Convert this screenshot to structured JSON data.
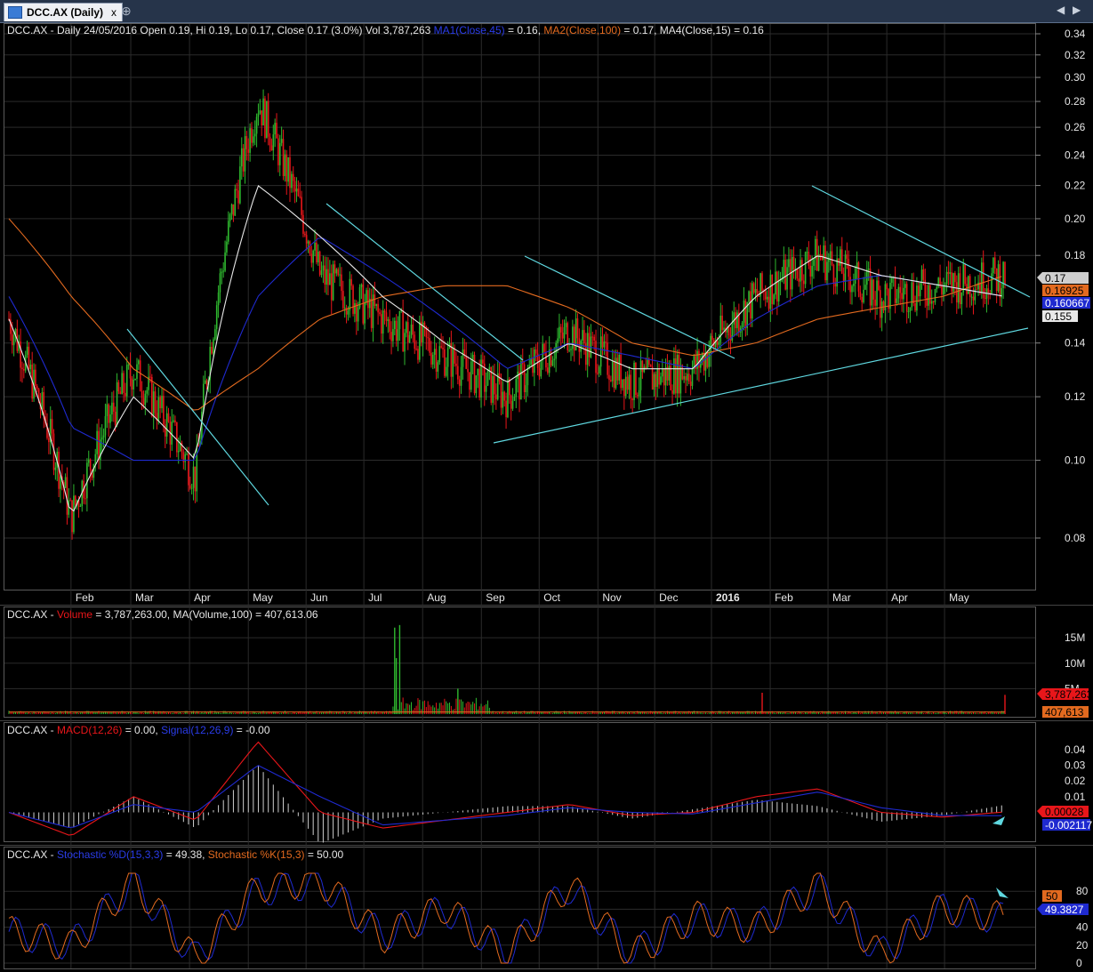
{
  "tab": {
    "title": "DCC.AX (Daily)",
    "close": "x",
    "pin": "⊕",
    "nav_prev": "◀",
    "nav_next": "▶"
  },
  "panes": {
    "price": {
      "info": {
        "ticker": "DCC.AX - Daily 24/05/2016 Open 0.19, Hi 0.19, Lo 0.17, Close 0.17 (3.0%) Vol 3,787,263 ",
        "ma1": "MA1(Close,45)",
        "ma1_val": " = 0.16, ",
        "ma2": "MA2(Close,100)",
        "ma2_val": " = 0.17, MA4(Close,15) = 0.16"
      },
      "tags": [
        "0.17",
        "0.16925",
        "0.160667",
        "0.155"
      ],
      "months": [
        "Feb",
        "Mar",
        "Apr",
        "May",
        "Jun",
        "Jul",
        "Aug",
        "Sep",
        "Oct",
        "Nov",
        "Dec",
        "2016",
        "Feb",
        "Mar",
        "Apr",
        "May"
      ],
      "y_ticks": [
        "0.34",
        "0.32",
        "0.30",
        "0.28",
        "0.26",
        "0.24",
        "0.22",
        "0.20",
        "0.18",
        "0.14",
        "0.12",
        "0.10",
        "0.08"
      ]
    },
    "volume": {
      "info": {
        "ticker": "DCC.AX - ",
        "vol": "Volume",
        "vol_val": " = 3,787,263.00, MA(Volume,100) = 407,613.06"
      },
      "tags": [
        "3,787,263",
        "407,613"
      ],
      "y_ticks": [
        "15M",
        "10M",
        "5M"
      ]
    },
    "macd": {
      "info": {
        "ticker": "DCC.AX - ",
        "macd": "MACD(12,26)",
        "macd_val": " = 0.00, ",
        "signal": "Signal(12,26,9)",
        "signal_val": " = -0.00"
      },
      "tags": [
        "0.00028",
        "-0.002117"
      ],
      "y_ticks": [
        "0.04",
        "0.03",
        "0.02",
        "0.01"
      ]
    },
    "stoch": {
      "info": {
        "ticker": "DCC.AX - ",
        "d": "Stochastic %D(15,3,3)",
        "d_val": " = 49.38, ",
        "k": "Stochastic %K(15,3)",
        "k_val": " = 50.00"
      },
      "tags": [
        "50",
        "49.3827"
      ],
      "y_ticks": [
        "80",
        "60",
        "40",
        "20",
        "0"
      ]
    }
  },
  "colors": {
    "bg": "#000000",
    "up": "#2fb82f",
    "down": "#e8161a",
    "ma_fast": "#e8e8e8",
    "ma_mid": "#1f2ad0",
    "ma_slow": "#e36a1f",
    "trend": "#5fd8e0",
    "grid": "#2b2b2b",
    "text": "#e6e6e6"
  },
  "chart_data": [
    {
      "type": "line",
      "title": "DCC.AX - Daily",
      "description_series": "Daily candlestick price with moving averages (approximate values read from chart)",
      "x": [
        "2015-01",
        "2015-02",
        "2015-03",
        "2015-04",
        "2015-05",
        "2015-06",
        "2015-07",
        "2015-08",
        "2015-09",
        "2015-10",
        "2015-11",
        "2015-12",
        "2016-01",
        "2016-02",
        "2016-03",
        "2016-04",
        "2016-05"
      ],
      "series": [
        {
          "name": "Close",
          "values": [
            0.15,
            0.085,
            0.13,
            0.095,
            0.28,
            0.17,
            0.15,
            0.135,
            0.12,
            0.145,
            0.125,
            0.13,
            0.16,
            0.18,
            0.16,
            0.165,
            0.17
          ]
        },
        {
          "name": "MA1(Close,45)",
          "values": [
            0.16,
            0.11,
            0.1,
            0.1,
            0.16,
            0.19,
            0.17,
            0.15,
            0.13,
            0.14,
            0.135,
            0.13,
            0.15,
            0.165,
            0.17,
            0.165,
            0.16
          ]
        },
        {
          "name": "MA2(Close,100)",
          "values": [
            0.2,
            0.16,
            0.13,
            0.115,
            0.13,
            0.15,
            0.16,
            0.165,
            0.165,
            0.155,
            0.14,
            0.135,
            0.14,
            0.15,
            0.155,
            0.16,
            0.17
          ]
        },
        {
          "name": "MA4(Close,15)",
          "values": [
            0.15,
            0.085,
            0.12,
            0.1,
            0.22,
            0.19,
            0.16,
            0.14,
            0.125,
            0.14,
            0.13,
            0.13,
            0.16,
            0.18,
            0.17,
            0.165,
            0.16
          ]
        }
      ],
      "ylim": [
        0.07,
        0.35
      ],
      "y_scale": "log",
      "grid": true,
      "last": {
        "open": 0.19,
        "high": 0.19,
        "low": 0.17,
        "close": 0.17,
        "volume": 3787263
      }
    },
    {
      "type": "bar",
      "title": "Volume",
      "x": [
        "2015-05-05",
        "2015-05-06",
        "2015-05-08",
        "2015-05-20",
        "2016-02-10",
        "2016-05-24"
      ],
      "values": [
        17000000,
        11000000,
        17500000,
        5000000,
        4200000,
        3787263
      ],
      "ma100": 407613.06,
      "ylim": [
        0,
        18000000
      ]
    },
    {
      "type": "line",
      "title": "MACD(12,26)",
      "series": [
        {
          "name": "MACD(12,26)",
          "values": [
            0.0,
            -0.015,
            0.01,
            -0.005,
            0.045,
            0.0,
            -0.01,
            -0.005,
            0.0,
            0.005,
            -0.002,
            0.0,
            0.01,
            0.015,
            0.0,
            -0.003,
            0.00028
          ]
        },
        {
          "name": "Signal(12,26,9)",
          "values": [
            0.0,
            -0.01,
            0.005,
            0.0,
            0.03,
            0.01,
            -0.008,
            -0.005,
            -0.002,
            0.003,
            0.0,
            -0.001,
            0.006,
            0.013,
            0.003,
            -0.002,
            -0.002117
          ]
        }
      ],
      "ylim": [
        -0.015,
        0.045
      ]
    },
    {
      "type": "line",
      "title": "Stochastic",
      "series": [
        {
          "name": "Stochastic %D(15,3,3)",
          "values": [
            35,
            20,
            90,
            5,
            80,
            90,
            30,
            60,
            10,
            85,
            10,
            50,
            40,
            85,
            10,
            60,
            49.38
          ]
        },
        {
          "name": "Stochastic %K(15,3)",
          "values": [
            35,
            18,
            92,
            3,
            85,
            92,
            28,
            62,
            8,
            88,
            8,
            52,
            38,
            88,
            8,
            62,
            50
          ]
        }
      ],
      "ylim": [
        0,
        100
      ]
    }
  ]
}
